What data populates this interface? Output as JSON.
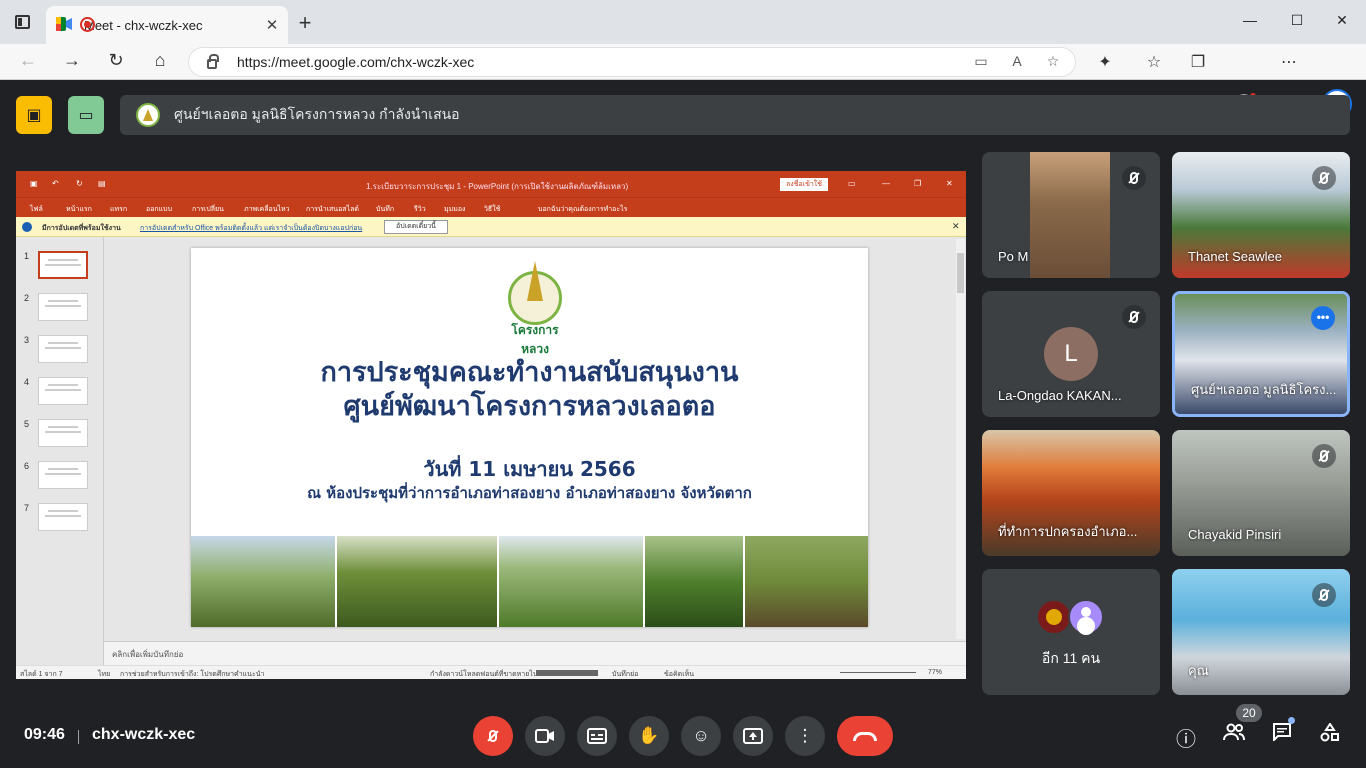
{
  "browser": {
    "tab_title": "Meet - chx-wczk-xec",
    "url": "https://meet.google.com/chx-wczk-xec"
  },
  "banner": {
    "text": "ศูนย์ฯเลอตอ มูลนิธิโครงการหลวง กำลังนำเสนอ"
  },
  "presentation": {
    "app_title": "1.ระเบียบวาระการประชุม 1 - PowerPoint (การเปิดใช้งานผลิตภัณฑ์ล้มเหลว)",
    "signin_label": "ลงชื่อเข้าใช้",
    "ribbon": [
      "ไฟล์",
      "หน้าแรก",
      "แทรก",
      "ออกแบบ",
      "การเปลี่ยน",
      "ภาพเคลื่อนไหว",
      "การนำเสนอสไลด์",
      "บันทึก",
      "รีวิว",
      "มุมมอง",
      "วิธีใช้",
      "บอกฉันว่าคุณต้องการทำอะไร"
    ],
    "info_title": "มีการอัปเดตที่พร้อมใช้งาน",
    "info_message": "การอัปเดตสำหรับ Office พร้อมติดตั้งแล้ว แต่เราจำเป็นต้องปิดบางแอปก่อน",
    "update_button": "อัปเดตเดี๋ยวนี้",
    "slide_numbers": [
      "1",
      "2",
      "3",
      "4",
      "5",
      "6",
      "7"
    ],
    "slide": {
      "emblem_label": "โครงการหลวง",
      "title_line1": "การประชุมคณะทำงานสนับสนุนงาน",
      "title_line2": "ศูนย์พัฒนาโครงการหลวงเลอตอ",
      "date": "วันที่  11  เมษายน 2566",
      "venue": "ณ ห้องประชุมที่ว่าการอำเภอท่าสองยาง  อำเภอท่าสองยาง จังหวัดตาก"
    },
    "notes_placeholder": "คลิกเพื่อเพิ่มบันทึกย่อ",
    "status_slide": "สไลด์ 1 จาก 7",
    "status_lang": "ไทย",
    "status_access": "การช่วยสำหรับการเข้าถึง: โปรดศึกษาคำแนะนำ",
    "status_upload": "กำลังดาวน์โหลดฟอนต์ที่ขาดหายไป...",
    "status_notes": "บันทึกย่อ",
    "status_comments": "ข้อคิดเห็น",
    "zoom": "77%"
  },
  "participants": [
    {
      "name": "Po M",
      "muted": true
    },
    {
      "name": "Thanet Seawlee",
      "muted": true
    },
    {
      "name": "La-Ongdao KAKAN...",
      "initial": "L",
      "muted": true
    },
    {
      "name": "ศูนย์ฯเลอตอ มูลนิธิโครง...",
      "muted": false
    },
    {
      "name": "ที่ทำการปกครองอำเภอ...",
      "muted": true
    },
    {
      "name": "Chayakid Pinsiri",
      "muted": true
    },
    {
      "name": "อีก 11 คน"
    },
    {
      "name": "คุณ",
      "muted": true
    }
  ],
  "bottom": {
    "time": "09:46",
    "meeting_code": "chx-wczk-xec",
    "people_count": "20"
  },
  "colors": {
    "meet_bg": "#202124",
    "tile_bg": "#3c4043",
    "end_call": "#ea4335",
    "ppt_accent": "#c43e1c",
    "yellow_btn": "#fbbc04",
    "green_btn": "#81c995"
  }
}
